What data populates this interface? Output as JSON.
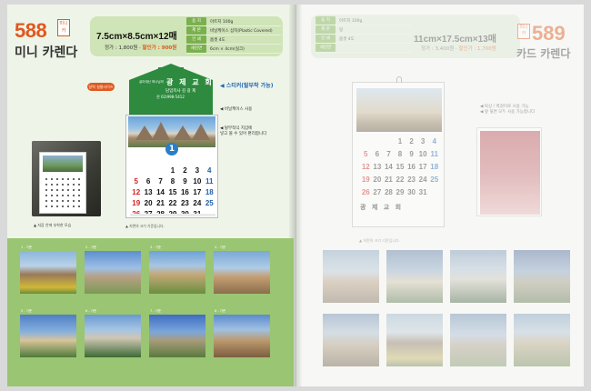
{
  "left": {
    "product_number": "588",
    "product_badge": "미니 카",
    "product_title": "미니 카렌다",
    "spec_size": "7.5cm×8.5cm×12매",
    "price_label": "정가 : 1,800원 · ",
    "sale_label": "할인가 : 900원",
    "specs": [
      {
        "k": "용 지",
        "v": "아트지 100g"
      },
      {
        "k": "제 본",
        "v": "비닐케이스 삽지(Plastic Covered)"
      },
      {
        "k": "인 쇄",
        "v": "옵셋 4도"
      },
      {
        "k": "새김면",
        "v": "6cm × 4cm(실크)"
      }
    ],
    "cal_tag": "달력 실물사이즈",
    "church": {
      "small": "살아계신 하나님의",
      "name": "광 제 교 회",
      "pastor": "담임목사 김 광 제",
      "tel": "전 02)998-5412"
    },
    "month": "1",
    "weeks": [
      [
        "",
        "",
        "",
        "",
        "",
        "",
        ""
      ],
      [
        "",
        "",
        "",
        "1",
        "2",
        "3",
        "4"
      ],
      [
        "5",
        "6",
        "7",
        "8",
        "9",
        "10",
        "11"
      ],
      [
        "12",
        "13",
        "14",
        "15",
        "16",
        "17",
        "18"
      ],
      [
        "19",
        "20",
        "21",
        "22",
        "23",
        "24",
        "25"
      ],
      [
        "26",
        "27",
        "28",
        "29",
        "30",
        "31",
        ""
      ]
    ],
    "label_sticker": "◀ 스티커(탈부착 가능)",
    "label_vinyl": "◀ 비닐케이스 사용",
    "label_wallet_1": "◀ 탈부착식 지갑에",
    "label_wallet_2": "넣고 볼 수 있어 편리합니다",
    "photo_caption": "▲ 지갑 안에 부착한 모습",
    "caption_bottom": "▲ 지면의 크기 기준입니다.",
    "thumb_captions": [
      "1 - 기준",
      "2 - 기준",
      "3 - 기준",
      "4 - 기준",
      "5 - 기준",
      "6 - 기준",
      "7 - 기준",
      "8 - 기준"
    ]
  },
  "right": {
    "product_number": "589",
    "product_badge": "미니 카",
    "product_title": "카드 카렌다",
    "spec_size": "11cm×17.5cm×13매",
    "price_label": "정가 : 3,400원 · ",
    "sale_label": "할인가 : 1,700원",
    "specs": [
      {
        "k": "용 지",
        "v": "아트지 100g"
      },
      {
        "k": "제 본",
        "v": "링"
      },
      {
        "k": "인 쇄",
        "v": "옵셋 4도"
      },
      {
        "k": "새김면",
        "v": ""
      }
    ],
    "weeks": [
      [
        "",
        "",
        "",
        "1",
        "2",
        "3",
        "4"
      ],
      [
        "5",
        "6",
        "7",
        "8",
        "9",
        "10",
        "11"
      ],
      [
        "12",
        "13",
        "14",
        "15",
        "16",
        "17",
        "18"
      ],
      [
        "19",
        "20",
        "21",
        "22",
        "23",
        "24",
        "25"
      ],
      [
        "26",
        "27",
        "28",
        "29",
        "30",
        "31",
        ""
      ]
    ],
    "footer": "광 제 교 회",
    "note_1": "◀ 탁상 / 벽걸이로 사용 가능",
    "note_2": "◀ 앞 뒷면 모두 사용 가능합니다",
    "caption": "▲ 지면의 크기 기준입니다."
  },
  "colors": {
    "accent_orange": "#e0581f",
    "green_label": "#7ab04d",
    "green_band": "#9ac572",
    "house_green": "#2d8a3e",
    "month_blue": "#2a7ec8"
  }
}
